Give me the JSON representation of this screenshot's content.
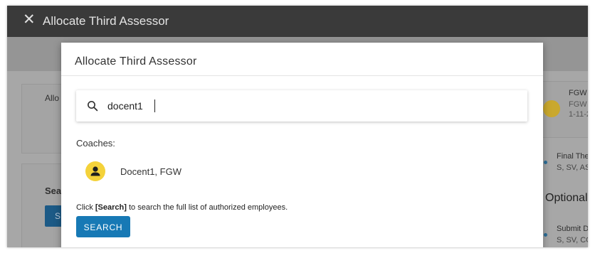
{
  "window": {
    "title": "Allocate Third Assessor",
    "close_icon": "close-icon"
  },
  "background": {
    "left_card_label": "Allo",
    "left_section_label": "Sea",
    "left_button_label": "S",
    "right_items": [
      {
        "line1": "FGW S",
        "line2": "FGW V",
        "line3": "1-11-2"
      },
      {
        "line1": "Final The",
        "line2": "S, SV, AS"
      },
      {
        "heading": "Optional"
      },
      {
        "line1": "Submit D",
        "line2": "S, SV, CO"
      }
    ],
    "colors": {
      "topbar": "#3a3a3a",
      "overlay": "#a7a7a7"
    }
  },
  "modal": {
    "title": "Allocate Third Assessor",
    "search": {
      "value": "docent1",
      "placeholder": "",
      "icon": "search-icon"
    },
    "coaches_label": "Coaches:",
    "coaches": [
      {
        "name": "Docent1, FGW",
        "avatar_icon": "person-icon",
        "avatar_color": "#f4d23a"
      }
    ],
    "hint_prefix": "Click ",
    "hint_strong": "[Search]",
    "hint_suffix": " to search the full list of authorized employees.",
    "search_button_label": "SEARCH",
    "accent_color": "#1779b5"
  }
}
